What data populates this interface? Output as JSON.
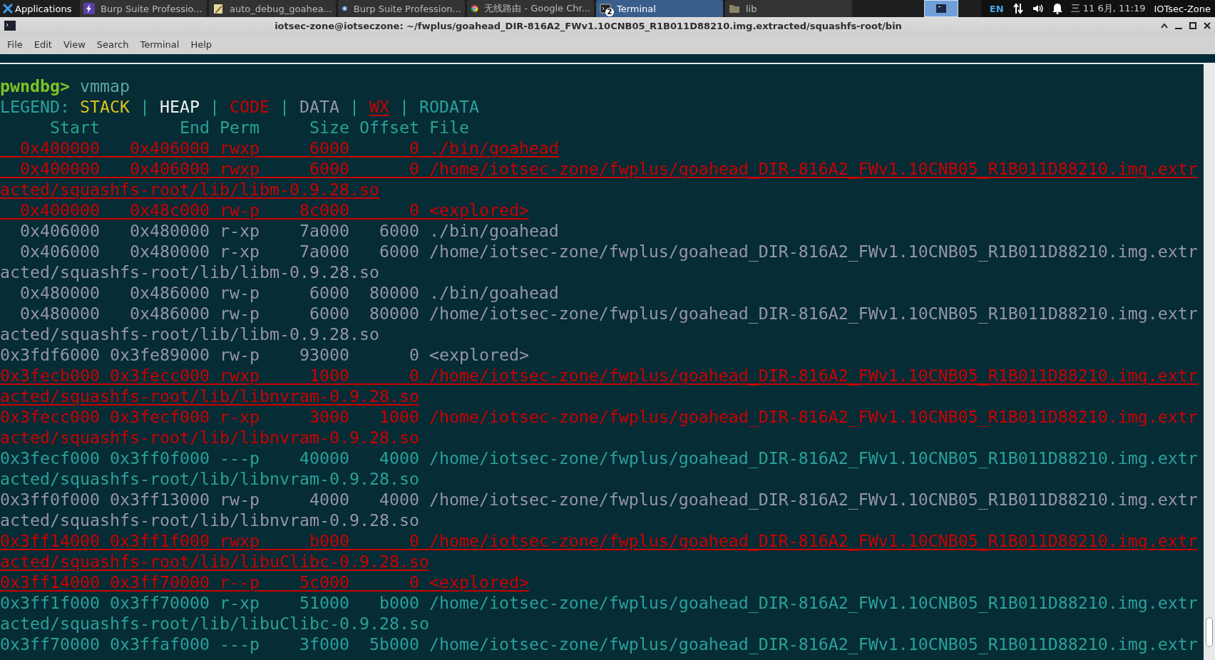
{
  "taskbar": {
    "apps_label": "Applications",
    "tasks": [
      {
        "label": "Burp Suite Professio...",
        "kind": "burp",
        "selected": false
      },
      {
        "label": "auto_debug_goahea...",
        "kind": "editor",
        "selected": false
      },
      {
        "label": "Burp Suite Profession...",
        "kind": "browser",
        "selected": false
      },
      {
        "label": "无线路由 - Google Chr...",
        "kind": "chrome",
        "selected": false
      },
      {
        "label": "Terminal",
        "kind": "terminal",
        "selected": true,
        "badge": "2"
      },
      {
        "label": "lib",
        "kind": "folder",
        "selected": false
      }
    ],
    "tray": {
      "language": "EN",
      "clock": "三 11 6月, 11:19",
      "user": "IOTsec-Zone"
    }
  },
  "window": {
    "title": "iotsec-zone@iotseczone: ~/fwplus/goahead_DIR-816A2_FWv1.10CNB05_R1B011D88210.img.extracted/squashfs-root/bin"
  },
  "menu": [
    "File",
    "Edit",
    "View",
    "Search",
    "Terminal",
    "Help"
  ],
  "terminal": {
    "prompt": "pwndbg>",
    "command": " vmmap",
    "legend": {
      "label": "LEGEND: ",
      "separator": " | ",
      "items": [
        {
          "text": "STACK",
          "kind": "stack"
        },
        {
          "text": "HEAP",
          "kind": "heap"
        },
        {
          "text": "CODE",
          "kind": "code"
        },
        {
          "text": "DATA",
          "kind": "data"
        },
        {
          "text": "WX",
          "kind": "wx"
        },
        {
          "text": "RODATA",
          "kind": "rodata"
        }
      ]
    },
    "header": "     Start        End Perm     Size Offset File",
    "mappings": [
      {
        "kind": "wx",
        "lines": [
          "  0x400000   0x406000 rwxp     6000      0 ./bin/goahead"
        ]
      },
      {
        "kind": "wx",
        "lines": [
          "  0x400000   0x406000 rwxp     6000      0 /home/iotsec-zone/fwplus/goahead_DIR-816A2_FWv1.10CNB05_R1B011D88210.img.extr",
          "acted/squashfs-root/lib/libm-0.9.28.so"
        ]
      },
      {
        "kind": "wx",
        "lines": [
          "  0x400000   0x48c000 rw-p    8c000      0 <explored>"
        ]
      },
      {
        "kind": "data",
        "lines": [
          "  0x406000   0x480000 r-xp    7a000   6000 ./bin/goahead"
        ]
      },
      {
        "kind": "data",
        "lines": [
          "  0x406000   0x480000 r-xp    7a000   6000 /home/iotsec-zone/fwplus/goahead_DIR-816A2_FWv1.10CNB05_R1B011D88210.img.extr",
          "acted/squashfs-root/lib/libm-0.9.28.so"
        ]
      },
      {
        "kind": "data",
        "lines": [
          "  0x480000   0x486000 rw-p     6000  80000 ./bin/goahead"
        ]
      },
      {
        "kind": "data",
        "lines": [
          "  0x480000   0x486000 rw-p     6000  80000 /home/iotsec-zone/fwplus/goahead_DIR-816A2_FWv1.10CNB05_R1B011D88210.img.extr",
          "acted/squashfs-root/lib/libm-0.9.28.so"
        ]
      },
      {
        "kind": "data",
        "lines": [
          "0x3fdf6000 0x3fe89000 rw-p    93000      0 <explored>"
        ]
      },
      {
        "kind": "wx",
        "lines": [
          "0x3fecb000 0x3fecc000 rwxp     1000      0 /home/iotsec-zone/fwplus/goahead_DIR-816A2_FWv1.10CNB05_R1B011D88210.img.extr",
          "acted/squashfs-root/lib/libnvram-0.9.28.so"
        ]
      },
      {
        "kind": "code",
        "lines": [
          "0x3fecc000 0x3fecf000 r-xp     3000   1000 /home/iotsec-zone/fwplus/goahead_DIR-816A2_FWv1.10CNB05_R1B011D88210.img.extr",
          "acted/squashfs-root/lib/libnvram-0.9.28.so"
        ]
      },
      {
        "kind": "rodata",
        "lines": [
          "0x3fecf000 0x3ff0f000 ---p    40000   4000 /home/iotsec-zone/fwplus/goahead_DIR-816A2_FWv1.10CNB05_R1B011D88210.img.extr",
          "acted/squashfs-root/lib/libnvram-0.9.28.so"
        ]
      },
      {
        "kind": "data",
        "lines": [
          "0x3ff0f000 0x3ff13000 rw-p     4000   4000 /home/iotsec-zone/fwplus/goahead_DIR-816A2_FWv1.10CNB05_R1B011D88210.img.extr",
          "acted/squashfs-root/lib/libnvram-0.9.28.so"
        ]
      },
      {
        "kind": "wx",
        "lines": [
          "0x3ff14000 0x3ff1f000 rwxp     b000      0 /home/iotsec-zone/fwplus/goahead_DIR-816A2_FWv1.10CNB05_R1B011D88210.img.extr",
          "acted/squashfs-root/lib/libuClibc-0.9.28.so"
        ]
      },
      {
        "kind": "wx",
        "lines": [
          "0x3ff14000 0x3ff70000 r--p    5c000      0 <explored>"
        ]
      },
      {
        "kind": "rodata",
        "lines": [
          "0x3ff1f000 0x3ff70000 r-xp    51000   b000 /home/iotsec-zone/fwplus/goahead_DIR-816A2_FWv1.10CNB05_R1B011D88210.img.extr",
          "acted/squashfs-root/lib/libuClibc-0.9.28.so"
        ]
      },
      {
        "kind": "rodata",
        "lines": [
          "0x3ff70000 0x3ffaf000 ---p    3f000  5b000 /home/iotsec-zone/fwplus/goahead_DIR-816A2_FWv1.10CNB05_R1B011D88210.img.extr"
        ]
      }
    ]
  }
}
